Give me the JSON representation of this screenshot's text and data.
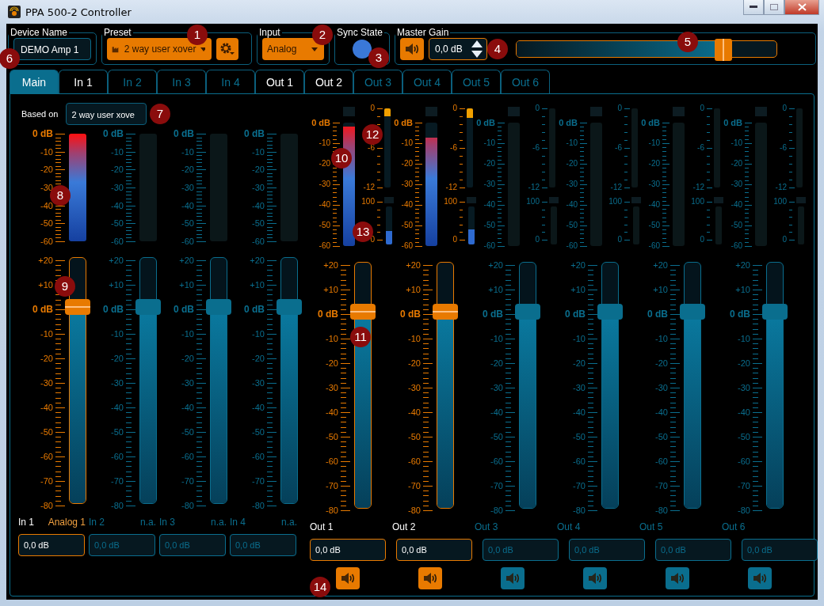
{
  "window": {
    "title": "PPA 500-2 Controller"
  },
  "device_name": {
    "label": "Device Name",
    "value": "DEMO Amp 1"
  },
  "preset": {
    "label": "Preset",
    "value": "2 way user xover"
  },
  "input": {
    "label": "Input",
    "value": "Analog"
  },
  "sync_state": {
    "label": "Sync State",
    "on": true
  },
  "master_gain": {
    "label": "Master Gain",
    "muted": false,
    "value": "0,0 dB",
    "level": 0.8
  },
  "tabs": [
    {
      "label": "Main",
      "selected": true,
      "active": true
    },
    {
      "label": "In 1",
      "selected": false,
      "active": true
    },
    {
      "label": "In 2",
      "selected": false,
      "active": false
    },
    {
      "label": "In 3",
      "selected": false,
      "active": false
    },
    {
      "label": "In 4",
      "selected": false,
      "active": false
    },
    {
      "label": "Out 1",
      "selected": false,
      "active": true
    },
    {
      "label": "Out 2",
      "selected": false,
      "active": true
    },
    {
      "label": "Out 3",
      "selected": false,
      "active": false
    },
    {
      "label": "Out 4",
      "selected": false,
      "active": false
    },
    {
      "label": "Out 5",
      "selected": false,
      "active": false
    },
    {
      "label": "Out 6",
      "selected": false,
      "active": false
    }
  ],
  "based_on": {
    "label": "Based on",
    "value": "2 way user xove"
  },
  "inputs": [
    {
      "name": "In 1",
      "source": "Analog 1",
      "active": true,
      "meter": {
        "level": 1
      },
      "fader": {
        "level": 0.8
      },
      "gain": "0,0 dB",
      "meter_scale": [
        "0 dB",
        "-10",
        "-20",
        "-30",
        "-40",
        "-50",
        "-60"
      ],
      "fader_scale": [
        "+20",
        "+10",
        "0 dB",
        "-10",
        "-20",
        "-30",
        "-40",
        "-50",
        "-60",
        "-70",
        "-80"
      ]
    },
    {
      "name": "In 2",
      "source": "n.a.",
      "active": false,
      "fader": {
        "level": 0.8
      },
      "gain": "0,0 dB",
      "meter_scale": [
        "0 dB",
        "-10",
        "-20",
        "-30",
        "-40",
        "-50",
        "-60"
      ],
      "fader_scale": [
        "+20",
        "+10",
        "0 dB",
        "-10",
        "-20",
        "-30",
        "-40",
        "-50",
        "-60",
        "-70",
        "-80"
      ]
    },
    {
      "name": "In 3",
      "source": "n.a.",
      "active": false,
      "fader": {
        "level": 0.8
      },
      "gain": "0,0 dB",
      "meter_scale": [
        "0 dB",
        "-10",
        "-20",
        "-30",
        "-40",
        "-50",
        "-60"
      ],
      "fader_scale": [
        "+20",
        "+10",
        "0 dB",
        "-10",
        "-20",
        "-30",
        "-40",
        "-50",
        "-60",
        "-70",
        "-80"
      ]
    },
    {
      "name": "In 4",
      "source": "n.a.",
      "active": false,
      "fader": {
        "level": 0.8
      },
      "gain": "0,0 dB",
      "meter_scale": [
        "0 dB",
        "-10",
        "-20",
        "-30",
        "-40",
        "-50",
        "-60"
      ],
      "fader_scale": [
        "+20",
        "+10",
        "0 dB",
        "-10",
        "-20",
        "-30",
        "-40",
        "-50",
        "-60",
        "-70",
        "-80"
      ]
    }
  ],
  "outputs": [
    {
      "name": "Out 1",
      "active": true,
      "meter": {
        "level": 0.97
      },
      "limiter": {
        "level": 0.1
      },
      "comp": {
        "level": 0.35
      },
      "fader": {
        "level": 0.8
      },
      "gain": "0,0 dB",
      "muted": false,
      "meter_scale": [
        "0 dB",
        "-10",
        "-20",
        "-30",
        "-40",
        "-50",
        "-60"
      ],
      "limiter_scale": [
        "0",
        "-6",
        "-12"
      ],
      "comp_scale": [
        "100",
        "0"
      ],
      "fader_scale": [
        "+20",
        "+10",
        "0 dB",
        "-10",
        "-20",
        "-30",
        "-40",
        "-50",
        "-60",
        "-70",
        "-80"
      ]
    },
    {
      "name": "Out 2",
      "active": true,
      "meter": {
        "level": 0.88
      },
      "limiter": {
        "level": 0.12
      },
      "comp": {
        "level": 0.4
      },
      "fader": {
        "level": 0.8
      },
      "gain": "0,0 dB",
      "muted": false,
      "meter_scale": [
        "0 dB",
        "-10",
        "-20",
        "-30",
        "-40",
        "-50",
        "-60"
      ],
      "limiter_scale": [
        "0",
        "-6",
        "-12"
      ],
      "comp_scale": [
        "100",
        "0"
      ],
      "fader_scale": [
        "+20",
        "+10",
        "0 dB",
        "-10",
        "-20",
        "-30",
        "-40",
        "-50",
        "-60",
        "-70",
        "-80"
      ]
    },
    {
      "name": "Out 3",
      "active": false,
      "fader": {
        "level": 0.8
      },
      "gain": "0,0 dB",
      "muted": false,
      "meter_scale": [
        "0 dB",
        "-10",
        "-20",
        "-30",
        "-40",
        "-50",
        "-60"
      ],
      "limiter_scale": [
        "0",
        "-6",
        "-12"
      ],
      "comp_scale": [
        "100",
        "0"
      ],
      "fader_scale": [
        "+20",
        "+10",
        "0 dB",
        "-10",
        "-20",
        "-30",
        "-40",
        "-50",
        "-60",
        "-70",
        "-80"
      ]
    },
    {
      "name": "Out 4",
      "active": false,
      "fader": {
        "level": 0.8
      },
      "gain": "0,0 dB",
      "muted": false,
      "meter_scale": [
        "0 dB",
        "-10",
        "-20",
        "-30",
        "-40",
        "-50",
        "-60"
      ],
      "limiter_scale": [
        "0",
        "-6",
        "-12"
      ],
      "comp_scale": [
        "100",
        "0"
      ],
      "fader_scale": [
        "+20",
        "+10",
        "0 dB",
        "-10",
        "-20",
        "-30",
        "-40",
        "-50",
        "-60",
        "-70",
        "-80"
      ]
    },
    {
      "name": "Out 5",
      "active": false,
      "fader": {
        "level": 0.8
      },
      "gain": "0,0 dB",
      "muted": false,
      "meter_scale": [
        "0 dB",
        "-10",
        "-20",
        "-30",
        "-40",
        "-50",
        "-60"
      ],
      "limiter_scale": [
        "0",
        "-6",
        "-12"
      ],
      "comp_scale": [
        "100",
        "0"
      ],
      "fader_scale": [
        "+20",
        "+10",
        "0 dB",
        "-10",
        "-20",
        "-30",
        "-40",
        "-50",
        "-60",
        "-70",
        "-80"
      ]
    },
    {
      "name": "Out 6",
      "active": false,
      "fader": {
        "level": 0.8
      },
      "gain": "0,0 dB",
      "muted": false,
      "meter_scale": [
        "0 dB",
        "-10",
        "-20",
        "-30",
        "-40",
        "-50",
        "-60"
      ],
      "limiter_scale": [
        "0",
        "-6",
        "-12"
      ],
      "comp_scale": [
        "100",
        "0"
      ],
      "fader_scale": [
        "+20",
        "+10",
        "0 dB",
        "-10",
        "-20",
        "-30",
        "-40",
        "-50",
        "-60",
        "-70",
        "-80"
      ]
    }
  ],
  "callouts": [
    "1",
    "2",
    "3",
    "4",
    "5",
    "6",
    "7",
    "8",
    "9",
    "10",
    "11",
    "12",
    "13",
    "14"
  ]
}
